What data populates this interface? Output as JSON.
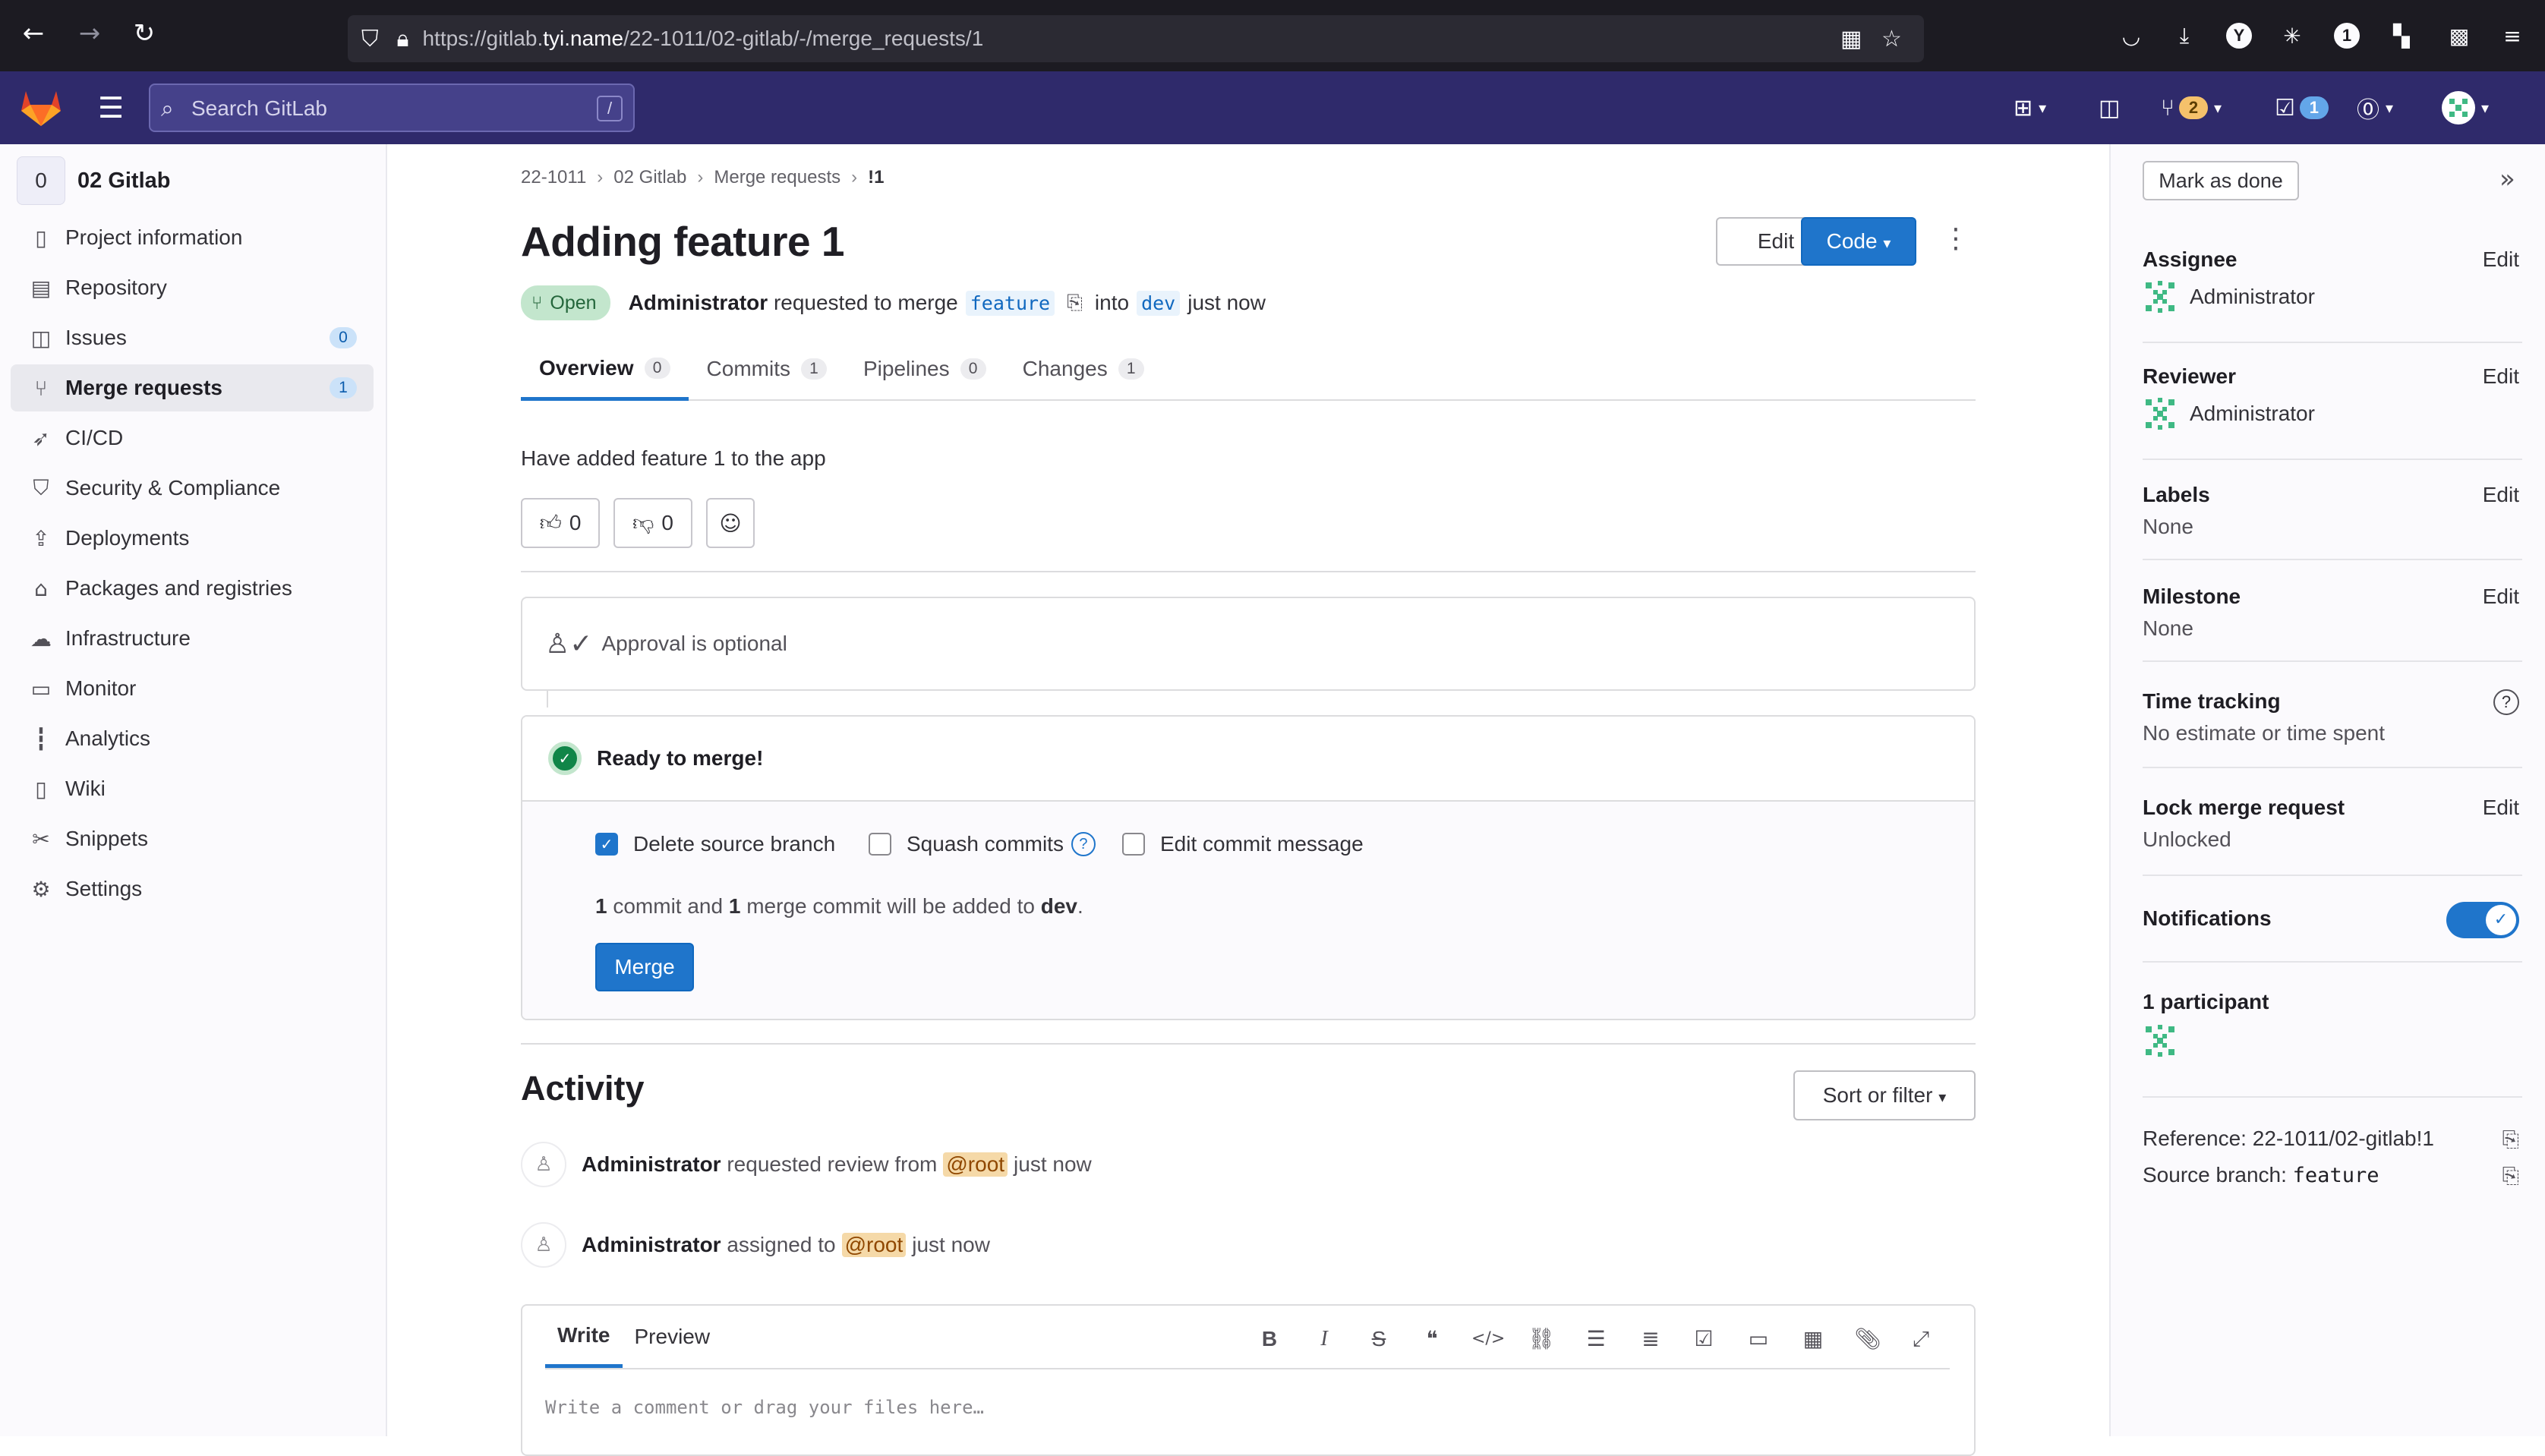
{
  "browser": {
    "url_prefix": "https://gitlab.",
    "url_host": "tyi.name",
    "url_path": "/22-1011/02-gitlab/-/merge_requests/1"
  },
  "topbar": {
    "search_placeholder": "Search GitLab",
    "search_shortcut": "/",
    "merge_requests_count": "2",
    "todos_count": "1",
    "brand_color": "#2f2a6b"
  },
  "sidebar": {
    "project_initial": "0",
    "project_name": "02 Gitlab",
    "items": [
      {
        "label": "Project information",
        "icon": "info-document-icon"
      },
      {
        "label": "Repository",
        "icon": "repository-icon"
      },
      {
        "label": "Issues",
        "icon": "issues-icon",
        "count": "0"
      },
      {
        "label": "Merge requests",
        "icon": "merge-request-icon",
        "count": "1",
        "active": true
      },
      {
        "label": "CI/CD",
        "icon": "rocket-icon"
      },
      {
        "label": "Security & Compliance",
        "icon": "shield-icon"
      },
      {
        "label": "Deployments",
        "icon": "deployments-icon"
      },
      {
        "label": "Packages and registries",
        "icon": "package-icon"
      },
      {
        "label": "Infrastructure",
        "icon": "cloud-gear-icon"
      },
      {
        "label": "Monitor",
        "icon": "monitor-icon"
      },
      {
        "label": "Analytics",
        "icon": "chart-icon"
      },
      {
        "label": "Wiki",
        "icon": "book-icon"
      },
      {
        "label": "Snippets",
        "icon": "snippet-icon"
      },
      {
        "label": "Settings",
        "icon": "gear-icon"
      }
    ]
  },
  "breadcrumb": [
    "22-1011",
    "02 Gitlab",
    "Merge requests",
    "!1"
  ],
  "mr": {
    "title": "Adding feature 1",
    "edit_label": "Edit",
    "code_label": "Code",
    "status": "Open",
    "author": "Administrator",
    "requested_text": "requested to merge",
    "source_branch": "feature",
    "into_text": "into",
    "target_branch": "dev",
    "time": "just now",
    "description": "Have added feature 1 to the app",
    "thumbs_up": "0",
    "thumbs_down": "0"
  },
  "tabs": [
    {
      "label": "Overview",
      "count": "0"
    },
    {
      "label": "Commits",
      "count": "1"
    },
    {
      "label": "Pipelines",
      "count": "0"
    },
    {
      "label": "Changes",
      "count": "1"
    }
  ],
  "approval": {
    "text": "Approval is optional"
  },
  "merge": {
    "title": "Ready to merge!",
    "delete_source": "Delete source branch",
    "squash": "Squash commits",
    "edit_message": "Edit commit message",
    "commit_count": "1",
    "commit_text_1": "commit and",
    "merge_commit_count": "1",
    "commit_text_2": "merge commit will be added to",
    "target": "dev",
    "button": "Merge"
  },
  "activity": {
    "title": "Activity",
    "sort_label": "Sort or filter",
    "events": [
      {
        "actor": "Administrator",
        "text": "requested review from",
        "mention": "@root",
        "time": "just now"
      },
      {
        "actor": "Administrator",
        "text": "assigned to",
        "mention": "@root",
        "time": "just now"
      }
    ]
  },
  "comment": {
    "write_tab": "Write",
    "preview_tab": "Preview",
    "placeholder": "Write a comment or drag your files here…"
  },
  "rightbar": {
    "mark_done": "Mark as done",
    "edit": "Edit",
    "assignee_title": "Assignee",
    "assignee": "Administrator",
    "reviewer_title": "Reviewer",
    "reviewer": "Administrator",
    "labels_title": "Labels",
    "labels_value": "None",
    "milestone_title": "Milestone",
    "milestone_value": "None",
    "time_title": "Time tracking",
    "time_value": "No estimate or time spent",
    "lock_title": "Lock merge request",
    "lock_value": "Unlocked",
    "notifications_title": "Notifications",
    "participants_title": "1 participant",
    "reference": "Reference: 22-1011/02-gitlab!1",
    "source_label": "Source branch:",
    "source_value": "feature"
  }
}
